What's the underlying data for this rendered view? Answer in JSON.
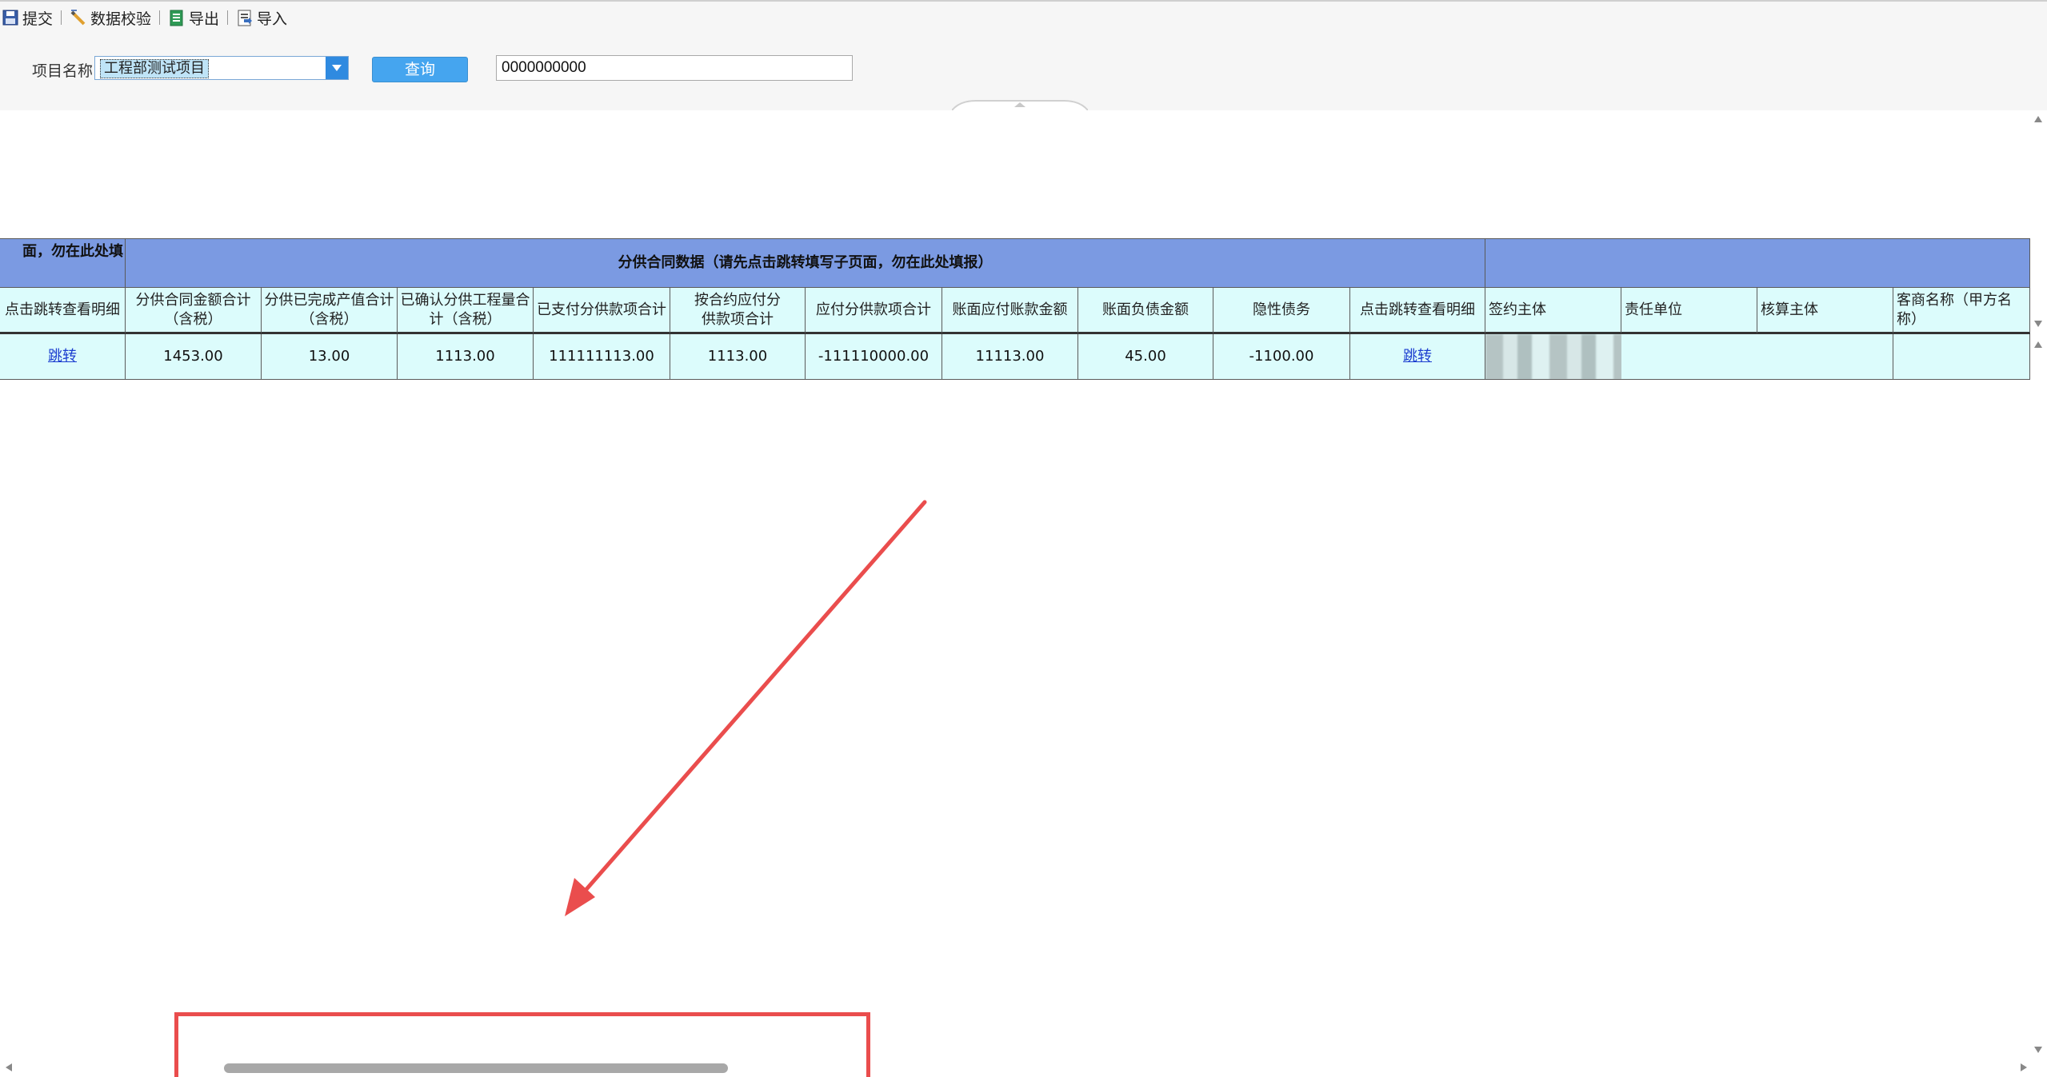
{
  "toolbar": {
    "items": [
      {
        "label": "提交",
        "icon": "save-icon"
      },
      {
        "label": "数据校验",
        "icon": "pencil-icon"
      },
      {
        "label": "导出",
        "icon": "export-icon"
      },
      {
        "label": "导入",
        "icon": "import-icon"
      }
    ]
  },
  "query": {
    "project_label": "项目名称",
    "project_value": "工程部测试项目",
    "query_button": "查询",
    "code_value": "0000000000"
  },
  "table": {
    "left_partial_group": "面，勿在此处填",
    "group_title": "分供合同数据（请先点击跳转填写子页面，勿在此处填报）",
    "columns": [
      "点击跳转查看明细",
      "分供合同金额合计（含税）",
      "分供已完成产值合计（含税）",
      "已确认分供工程量合计（含税）",
      "已支付分供款项合计",
      "按合约应付分供款项合计",
      "应付分供款项合计",
      "账面应付账款金额",
      "账面负债金额",
      "隐性债务",
      "点击跳转查看明细",
      "签约主体",
      "责任单位",
      "核算主体",
      "客商名称（甲方名称）"
    ],
    "row": [
      "跳转",
      "1453.00",
      "13.00",
      "1113.00",
      "111111113.00",
      "1113.00",
      "-111110000.00",
      "11113.00",
      "45.00",
      "-1100.00",
      "跳转",
      "",
      "",
      "",
      ""
    ]
  },
  "colors": {
    "group_header": "#7b9ae2",
    "sub_header": "#dcfcfc",
    "query_button": "#45a5ef",
    "annotation": "#ea4d4d",
    "link": "#1a3ccf"
  }
}
